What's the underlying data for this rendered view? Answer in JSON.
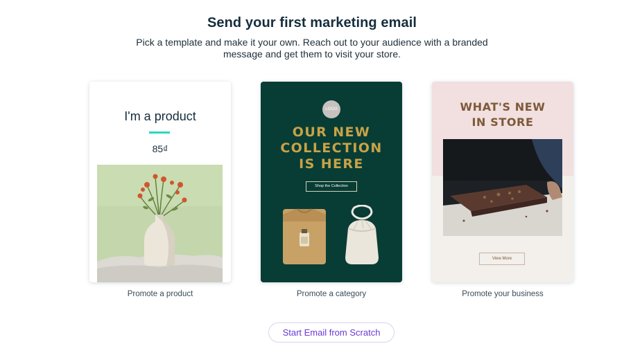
{
  "header": {
    "title": "Send your first marketing email",
    "subtitle": "Pick a template and make it your own. Reach out to your audience with a branded message and get them to visit your store."
  },
  "cards": [
    {
      "label": "Promote a product",
      "preview": {
        "product_title": "I'm a product",
        "price": "85₫"
      }
    },
    {
      "label": "Promote a category",
      "preview": {
        "logo_text": "LOGO",
        "headline_line1": "OUR NEW",
        "headline_line2": "COLLECTION",
        "headline_line3": "IS HERE",
        "button_label": "Shop the Collection"
      }
    },
    {
      "label": "Promote your business",
      "preview": {
        "headline_line1": "WHAT'S NEW",
        "headline_line2": "IN STORE",
        "button_label": "View More"
      }
    }
  ],
  "footer": {
    "scratch_button_label": "Start Email from Scratch"
  },
  "colors": {
    "accent_purple": "#6b39d3",
    "underline_teal": "#2ad6c2",
    "category_bg": "#073d35",
    "category_gold": "#c9a247",
    "business_pink": "#f2dfdf"
  }
}
